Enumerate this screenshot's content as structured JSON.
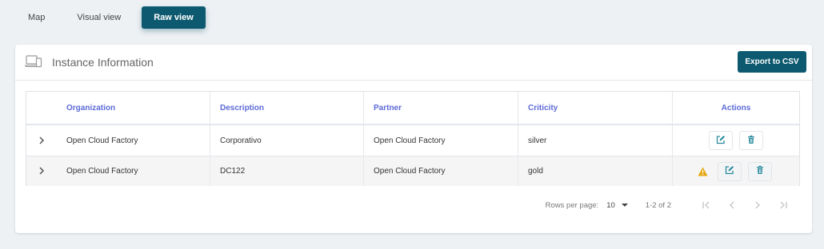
{
  "tabs": [
    {
      "label": "Map",
      "active": false
    },
    {
      "label": "Visual view",
      "active": false
    },
    {
      "label": "Raw view",
      "active": true
    }
  ],
  "card": {
    "icon": "laptop-phone-icon",
    "title": "Instance Information",
    "export_label": "Export to CSV"
  },
  "table": {
    "columns": [
      "Organization",
      "Description",
      "Partner",
      "Criticity",
      "Actions"
    ],
    "rows": [
      {
        "organization": "Open Cloud Factory",
        "description": "Corporativo",
        "partner": "Open Cloud Factory",
        "criticity": "silver",
        "warning": false
      },
      {
        "organization": "Open Cloud Factory",
        "description": "DC122",
        "partner": "Open Cloud Factory",
        "criticity": "gold",
        "warning": true
      }
    ]
  },
  "pagination": {
    "rows_label": "Rows per page:",
    "rows_value": "10",
    "range": "1-2 of 2"
  },
  "colors": {
    "primary": "#0d5a70",
    "header_text": "#5c6ad6",
    "warning": "#e5a710",
    "action_icon": "#2a8a9e"
  }
}
